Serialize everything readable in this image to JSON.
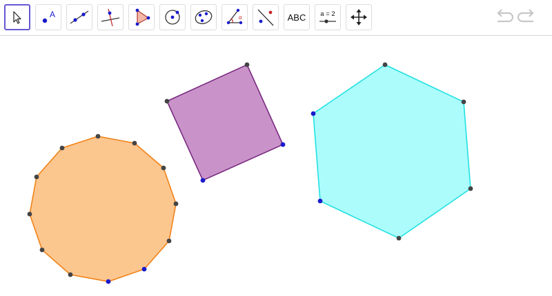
{
  "toolbar": {
    "tools": [
      {
        "icon": "move-arrow-icon",
        "selected": true
      },
      {
        "icon": "point-icon",
        "label": "A"
      },
      {
        "icon": "line-icon"
      },
      {
        "icon": "perpendicular-line-icon"
      },
      {
        "icon": "polygon-icon"
      },
      {
        "icon": "circle-center-point-icon"
      },
      {
        "icon": "conic-through-points-icon"
      },
      {
        "icon": "angle-icon",
        "label": "α"
      },
      {
        "icon": "reflect-about-line-icon"
      },
      {
        "icon": "text-icon",
        "label": "ABC"
      },
      {
        "icon": "slider-icon",
        "label": "a = 2"
      },
      {
        "icon": "move-graphics-view-icon"
      }
    ],
    "undo_icon": "undo-icon",
    "redo_icon": "redo-icon"
  },
  "colors": {
    "accent": "#6557d2",
    "dodecagon_fill": "#fcc68f",
    "dodecagon_stroke": "#f08218",
    "square_fill": "#c993ca",
    "square_stroke": "#7a2a80",
    "hexagon_fill": "#acfcfc",
    "hexagon_stroke": "#22e0e0",
    "free_point": "#1a1acc",
    "dependent_point": "#444444"
  }
}
